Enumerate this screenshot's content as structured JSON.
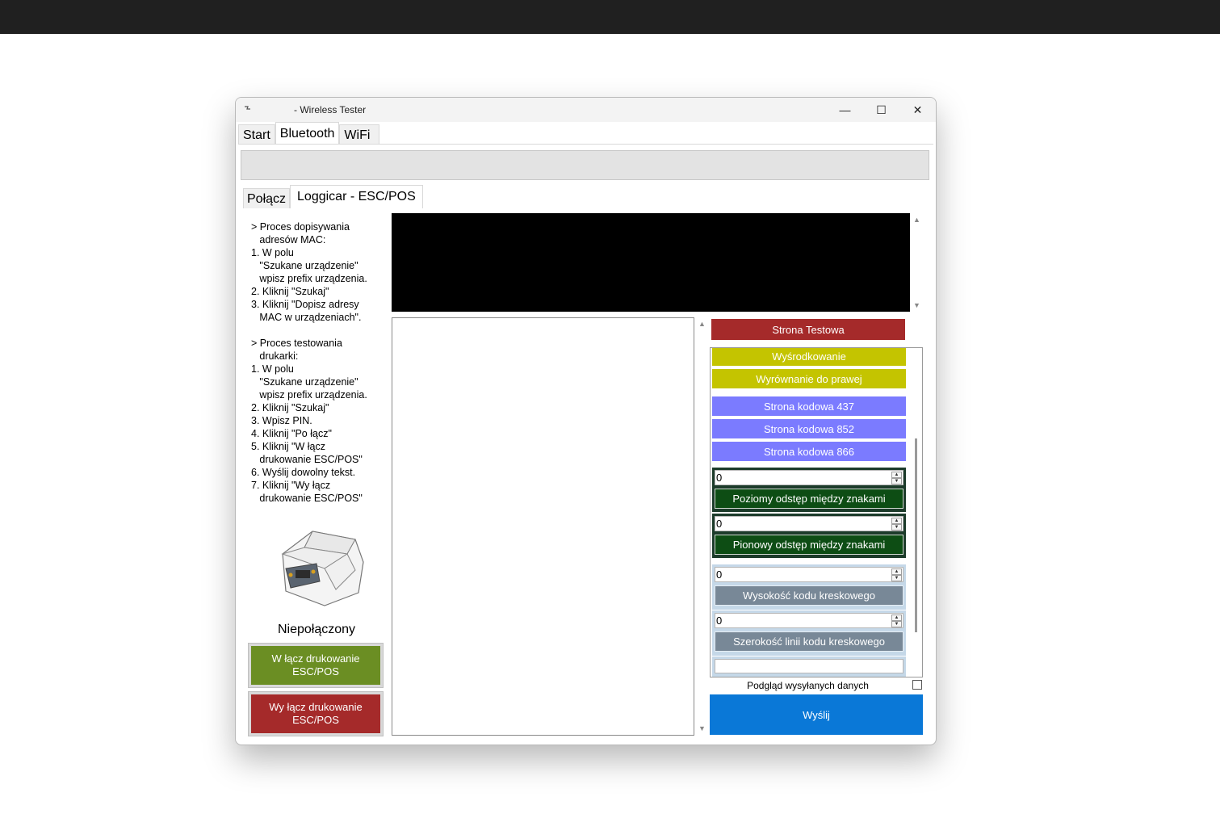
{
  "window": {
    "title": "- Wireless Tester",
    "controls": {
      "minimize": "—",
      "maximize": "☐",
      "close": "✕"
    }
  },
  "main_tabs": [
    "Start",
    "Bluetooth",
    "WiFi"
  ],
  "sub_tabs": [
    "Połącz",
    "Loggicar - ESC/POS"
  ],
  "instructions": "> Proces dopisywania\n   adresów MAC:\n1. W polu\n   \"Szukane urządzenie\"\n   wpisz prefix urządzenia.\n2. Kliknij \"Szukaj\"\n3. Kliknij \"Dopisz adresy\n   MAC w urządzeniach\".\n\n> Proces testowania\n   drukarki:\n1. W polu\n   \"Szukane urządzenie\"\n   wpisz prefix urządzenia.\n2. Kliknij \"Szukaj\"\n3. Wpisz PIN.\n4. Kliknij \"Po łącz\"\n5. Kliknij \"W łącz\n   drukowanie ESC/POS\"\n6. Wyślij dowolny tekst.\n7. Kliknij \"Wy łącz\n   drukowanie ESC/POS\"",
  "status": "Niepołączony",
  "buttons": {
    "enable": "W łącz drukowanie\nESC/POS",
    "disable": "Wy łącz drukowanie\nESC/POS",
    "test_page": "Strona Testowa",
    "center": "Wyśrodkowanie",
    "align_right": "Wyrównanie do prawej",
    "codepage_437": "Strona kodowa 437",
    "codepage_852": "Strona kodowa 852",
    "codepage_866": "Strona kodowa 866",
    "h_spacing": "Poziomy odstęp między znakami",
    "v_spacing": "Pionowy odstęp między znakami",
    "barcode_height": "Wysokość kodu kreskowego",
    "barcode_width": "Szerokość linii kodu kreskowego",
    "send": "Wyślij"
  },
  "spinners": {
    "h_spacing": "0",
    "v_spacing": "0",
    "barcode_height": "0",
    "barcode_width": "0"
  },
  "preview_label": "Podgląd wysyłanych danych",
  "colors": {
    "enable": "#6b8e23",
    "disable": "#a52a2a",
    "send": "#0a78d7"
  },
  "icons": [
    "app-icon",
    "minimize-icon",
    "maximize-icon",
    "close-icon",
    "printer-image",
    "scroll-up-icon",
    "scroll-down-icon",
    "spin-up-icon",
    "spin-down-icon"
  ]
}
